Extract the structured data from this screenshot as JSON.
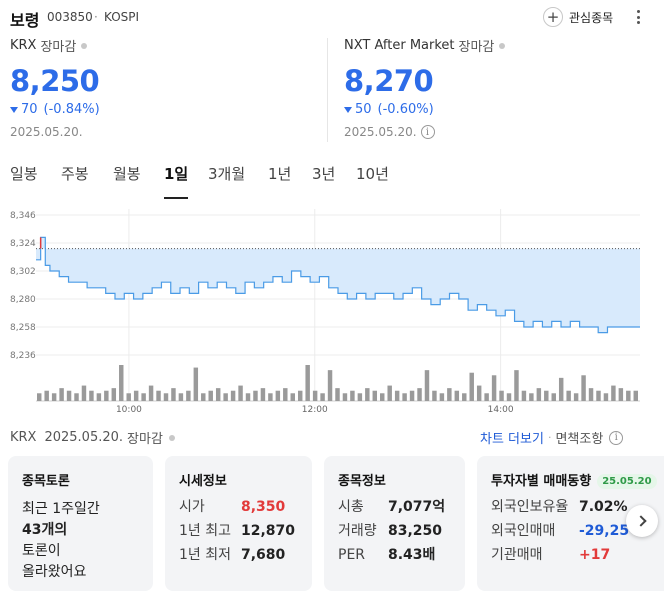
{
  "header": {
    "name": "보령",
    "code": "003850",
    "separator": "·",
    "market": "KOSPI",
    "favorite_label": "관심종목",
    "favorite_icon": "plus-icon",
    "more_icon": "more-vertical-icon"
  },
  "krx": {
    "title": "KRX",
    "status": "장마감",
    "price": "8,250",
    "change": "70",
    "change_pct": "(-0.84%)",
    "date": "2025.05.20.",
    "direction_icon": "down-triangle-icon"
  },
  "nxt": {
    "title": "NXT After Market",
    "status": "장마감",
    "price": "8,270",
    "change": "50",
    "change_pct": "(-0.60%)",
    "date": "2025.05.20.",
    "info_icon": "info-icon",
    "info_glyph": "i"
  },
  "tabs": [
    "일봉",
    "주봉",
    "월봉",
    "1일",
    "3개월",
    "1년",
    "3년",
    "10년"
  ],
  "active_tab": "1일",
  "colors": {
    "down": "#2d6ce8",
    "up": "#e23a3a",
    "area_fill": "#d8eafc",
    "line": "#4a9be6"
  },
  "chart_data": {
    "type": "area",
    "y_ticks": [
      "8,346",
      "8,324",
      "8,302",
      "8,280",
      "8,258",
      "8,236"
    ],
    "ylim": [
      8225,
      8350
    ],
    "x_ticks": [
      "10:00",
      "12:00",
      "14:00"
    ],
    "x_tick_positions": [
      10,
      12,
      14
    ],
    "xlim": [
      9,
      15.5
    ],
    "reference_price": 8320,
    "series": [
      {
        "x": [
          9.0,
          9.05,
          9.1,
          9.15,
          9.25,
          9.35,
          9.45,
          9.55,
          9.65,
          9.75,
          9.85,
          9.95,
          10.05,
          10.15,
          10.25,
          10.35,
          10.45,
          10.55,
          10.65,
          10.75,
          10.85,
          10.95,
          11.05,
          11.15,
          11.25,
          11.35,
          11.45,
          11.55,
          11.65,
          11.75,
          11.85,
          11.95,
          12.05,
          12.15,
          12.25,
          12.35,
          12.45,
          12.55,
          12.65,
          12.75,
          12.85,
          12.95,
          13.05,
          13.15,
          13.25,
          13.35,
          13.45,
          13.55,
          13.65,
          13.75,
          13.85,
          13.95,
          14.05,
          14.15,
          14.25,
          14.35,
          14.45,
          14.55,
          14.65,
          14.75,
          14.85,
          14.95,
          15.05,
          15.15,
          15.25,
          15.35,
          15.45,
          15.5
        ],
        "values": [
          8310,
          8330,
          8305,
          8300,
          8295,
          8290,
          8290,
          8285,
          8285,
          8280,
          8275,
          8280,
          8275,
          8280,
          8285,
          8290,
          8280,
          8285,
          8280,
          8290,
          8285,
          8290,
          8285,
          8280,
          8290,
          8285,
          8290,
          8295,
          8290,
          8300,
          8295,
          8290,
          8295,
          8285,
          8280,
          8275,
          8280,
          8275,
          8280,
          8280,
          8275,
          8280,
          8285,
          8275,
          8270,
          8275,
          8280,
          8275,
          8265,
          8270,
          8265,
          8260,
          8265,
          8255,
          8250,
          8255,
          8250,
          8255,
          8250,
          8255,
          8250,
          8250,
          8245,
          8250,
          8250,
          8250,
          8250,
          8250
        ]
      }
    ],
    "volume": [
      3,
      4,
      3,
      5,
      4,
      3,
      6,
      4,
      3,
      4,
      5,
      14,
      3,
      4,
      3,
      6,
      4,
      3,
      5,
      3,
      4,
      13,
      3,
      4,
      5,
      3,
      4,
      6,
      3,
      4,
      5,
      3,
      4,
      5,
      3,
      4,
      14,
      4,
      3,
      12,
      5,
      3,
      4,
      3,
      5,
      4,
      3,
      6,
      4,
      3,
      4,
      5,
      12,
      4,
      3,
      5,
      4,
      3,
      11,
      6,
      3,
      10,
      4,
      3,
      12,
      4,
      3,
      5,
      4,
      3,
      9,
      4,
      3,
      10,
      5,
      4,
      3,
      6,
      5,
      4,
      4
    ]
  },
  "meta": {
    "exchange": "KRX",
    "date": "2025.05.20.",
    "status": "장마감",
    "chart_link": "차트 더보기",
    "separator": "·",
    "disclaimer": "면책조항"
  },
  "cards": {
    "discussion": {
      "title": "종목토론",
      "lines": [
        "최근 1주일간",
        "43개의",
        "토론이",
        "올라왔어요"
      ]
    },
    "quote": {
      "title": "시세정보",
      "rows": [
        {
          "label": "시가",
          "value": "8,350"
        },
        {
          "label": "1년 최고",
          "value": "12,870"
        },
        {
          "label": "1년 최저",
          "value": "7,680"
        }
      ]
    },
    "stock_info": {
      "title": "종목정보",
      "rows": [
        {
          "label": "시총",
          "value": "7,077억"
        },
        {
          "label": "거래량",
          "value": "83,250"
        },
        {
          "label": "PER",
          "value": "8.43배"
        }
      ]
    },
    "investor": {
      "title": "투자자별 매매동향",
      "badge": "25.05.20",
      "rows": [
        {
          "label": "외국인보유율",
          "value": "7.02%"
        },
        {
          "label": "외국인매매",
          "value": "-29,25"
        },
        {
          "label": "기관매매",
          "value": "+17"
        }
      ]
    },
    "next_icon": "chevron-right-icon"
  }
}
